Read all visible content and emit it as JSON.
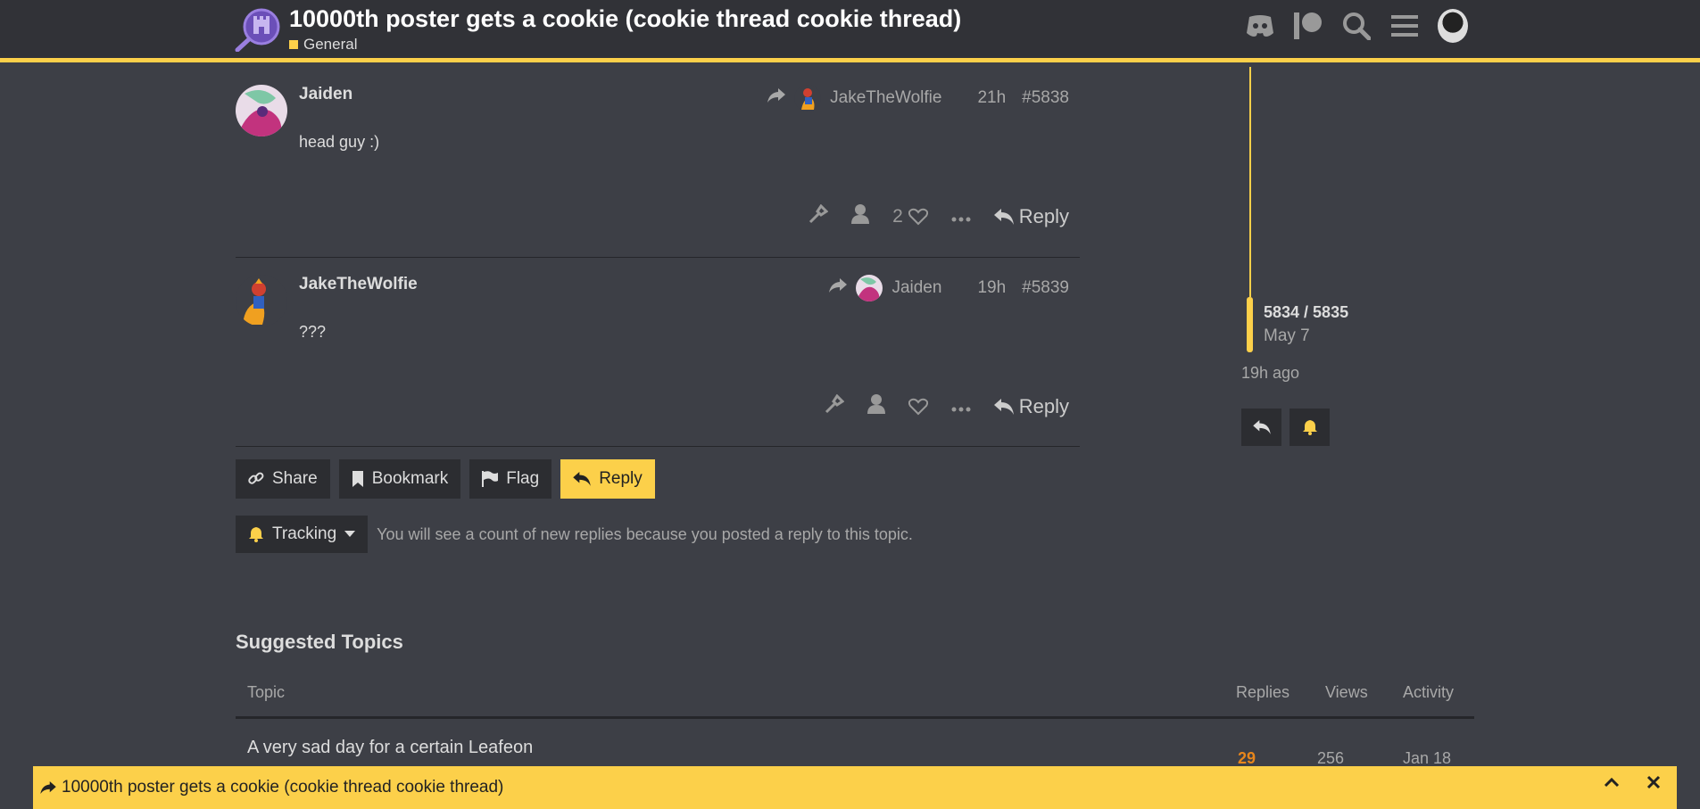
{
  "header": {
    "topic_title": "10000th poster gets a cookie (cookie thread cookie thread)",
    "category": "General",
    "category_color": "#fcd04a",
    "icons": [
      "discord-icon",
      "patreon-icon",
      "search-icon",
      "hamburger-menu-icon",
      "user-avatar"
    ]
  },
  "posts": [
    {
      "username": "Jaiden",
      "reply_to_user": "JakeTheWolfie",
      "time": "21h",
      "post_number": "#5838",
      "body": "head guy :)",
      "like_count": "2",
      "reply_label": "Reply"
    },
    {
      "username": "JakeTheWolfie",
      "reply_to_user": "Jaiden",
      "time": "19h",
      "post_number": "#5839",
      "body": "???",
      "like_count": "",
      "reply_label": "Reply"
    }
  ],
  "actions": {
    "share": "Share",
    "bookmark": "Bookmark",
    "flag": "Flag",
    "reply": "Reply"
  },
  "tracking": {
    "label": "Tracking",
    "description": "You will see a count of new replies because you posted a reply to this topic."
  },
  "timeline": {
    "position": "5834 / 5835",
    "date": "May 7",
    "ago": "19h ago"
  },
  "suggested": {
    "title": "Suggested Topics",
    "columns": {
      "topic": "Topic",
      "replies": "Replies",
      "views": "Views",
      "activity": "Activity"
    },
    "rows": [
      {
        "topic": "A very sad day for a certain Leafeon",
        "replies": "29",
        "views": "256",
        "activity": "Jan 18"
      }
    ]
  },
  "bottom_bar": {
    "title": "10000th poster gets a cookie (cookie thread cookie thread)"
  },
  "colors": {
    "accent": "#fcd04a",
    "background": "#3d3f46",
    "header": "#313237",
    "hot_replies": "#e8861b"
  }
}
